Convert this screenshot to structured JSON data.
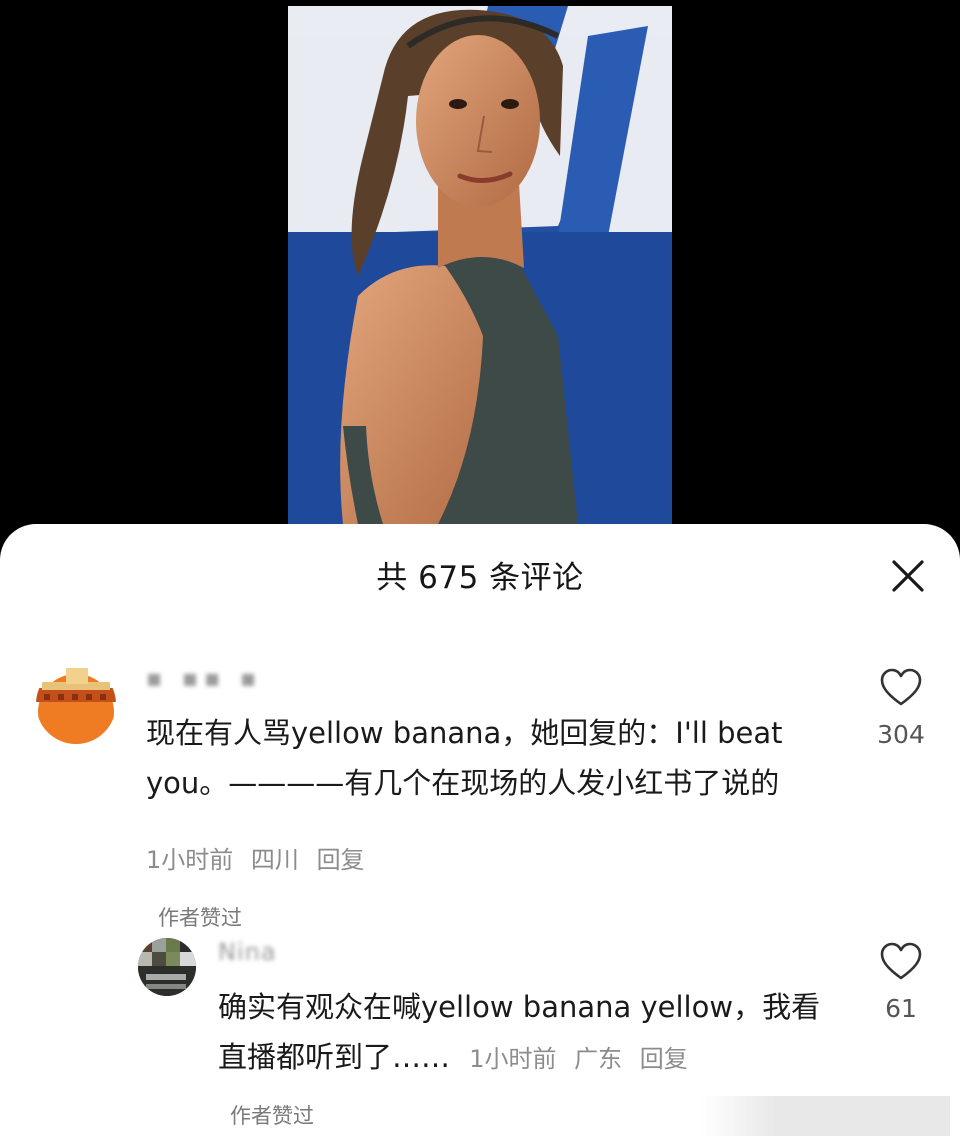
{
  "sheet": {
    "title": "共 675 条评论"
  },
  "comments": [
    {
      "username": "▪ ▪▪ ▪",
      "text": "现在有人骂yellow banana，她回复的：I'll beat you。————有几个在现场的人发小红书了说的",
      "time": "1小时前",
      "location": "四川",
      "reply_label": "回复",
      "liked_by_author": "作者赞过",
      "like_count": "304"
    },
    {
      "username": "Nina",
      "text": "确实有观众在喊yellow banana yellow，我看直播都听到了……",
      "time": "1小时前",
      "location": "广东",
      "reply_label": "回复",
      "liked_by_author": "作者赞过",
      "like_count": "61"
    }
  ],
  "colors": {
    "sheet_bg": "#ffffff",
    "page_bg": "#000000",
    "video_bg": "#1f4a9c",
    "text_primary": "#1a1a1a",
    "text_secondary": "#8c8c8c"
  },
  "icons": {
    "close": "close-icon",
    "like": "heart-outline-icon"
  }
}
